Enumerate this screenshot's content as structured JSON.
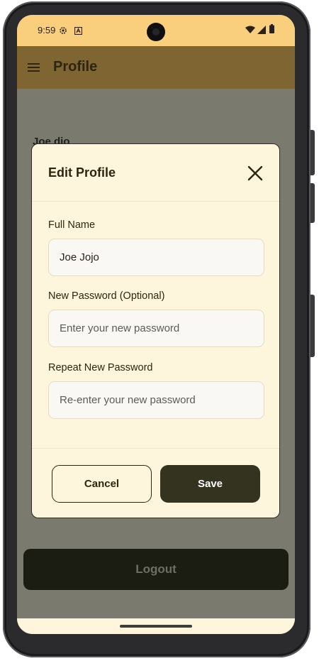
{
  "status_bar": {
    "time": "9:59",
    "icons": [
      "settings-gear-icon",
      "keyboard-a-icon",
      "wifi-icon",
      "cell-signal-icon",
      "battery-icon"
    ]
  },
  "app_bar": {
    "title": "Profile",
    "menu_icon": "hamburger-menu-icon"
  },
  "background": {
    "user_name_partial": "Joe dio",
    "logout_label": "Logout"
  },
  "dialog": {
    "title": "Edit Profile",
    "close_icon": "close-x-icon",
    "fields": [
      {
        "label": "Full Name",
        "value": "Joe Jojo",
        "placeholder": ""
      },
      {
        "label": "New Password (Optional)",
        "value": "",
        "placeholder": "Enter your new password"
      },
      {
        "label": "Repeat New Password",
        "value": "",
        "placeholder": "Re-enter your new password"
      }
    ],
    "cancel_label": "Cancel",
    "save_label": "Save"
  },
  "colors": {
    "status_bar": "#f9ce7c",
    "app_bar": "#7e6532",
    "dialog_bg": "#fdf6dc",
    "save_button": "#33331f",
    "logout_button": "#1c1d12",
    "scrim": "#7b7a6f"
  }
}
